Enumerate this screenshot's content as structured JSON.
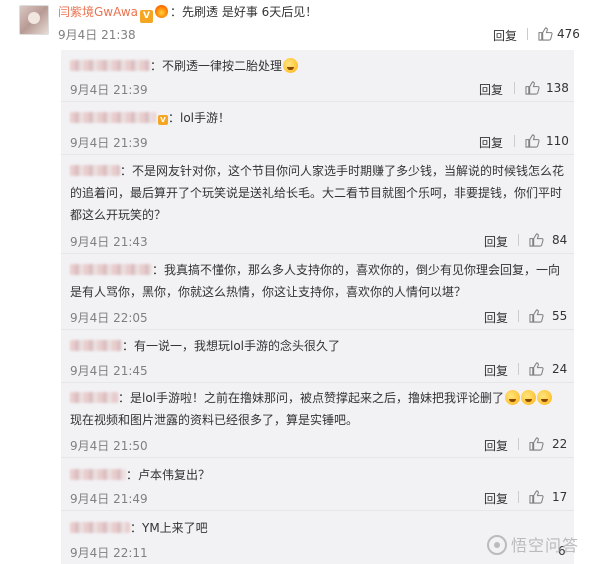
{
  "main": {
    "username": "闫紫境GwAwa",
    "text": "：先刷透 是好事 6天后见！",
    "date": "9月4日 21:38",
    "reply_label": "回复",
    "likes": "476"
  },
  "comments": [
    {
      "text": "：不刷透一律按二胎处理",
      "date": "9月4日 21:39",
      "reply_label": "回复",
      "likes": "138"
    },
    {
      "text": "：lol手游！",
      "date": "9月4日 21:39",
      "reply_label": "回复",
      "likes": "110"
    },
    {
      "text_lines": [
        "：不是网友针对你，这个节目你问人家选手时期赚了多少钱，当解说的时候钱怎么花",
        "的追着问，最后算开了个玩笑说是送礼给长毛。大二看节目就图个乐呵，非要提钱，你们平时",
        "都这么开玩笑的？"
      ],
      "date": "9月4日 21:43",
      "reply_label": "回复",
      "likes": "84"
    },
    {
      "text_lines": [
        "：我真搞不懂你，那么多人支持你的，喜欢你的，倒少有见你理会回复，一向",
        "是有人骂你，黑你，你就这么热情，你这让支持你，喜欢你的人情何以堪？"
      ],
      "date": "9月4日 22:05",
      "reply_label": "回复",
      "likes": "55"
    },
    {
      "text": "：有一说一，我想玩lol手游的念头很久了",
      "date": "9月4日 21:45",
      "reply_label": "回复",
      "likes": "24"
    },
    {
      "text_lines": [
        "：是lol手游啦！之前在撸妹那问，被点赞撑起来之后，撸妹把我评论删了",
        "现在视频和图片泄露的资料已经很多了，算是实锤吧。"
      ],
      "date": "9月4日 21:50",
      "reply_label": "回复",
      "likes": "22"
    },
    {
      "text": "：卢本伟复出？",
      "date": "9月4日 21:49",
      "reply_label": "回复",
      "likes": "17"
    },
    {
      "text": "：YM上来了吧",
      "date": "9月4日 22:11",
      "reply_label": "回复",
      "likes": "6"
    }
  ],
  "watermark": "悟空问答",
  "colors": {
    "username": "#eb7350",
    "date": "#808080",
    "subbg": "#f2f2f5"
  },
  "icons": {
    "like": "thumb-up-icon",
    "verified": "v-badge-icon",
    "fire": "fire-icon",
    "emoji": "grin-emoji-icon"
  }
}
